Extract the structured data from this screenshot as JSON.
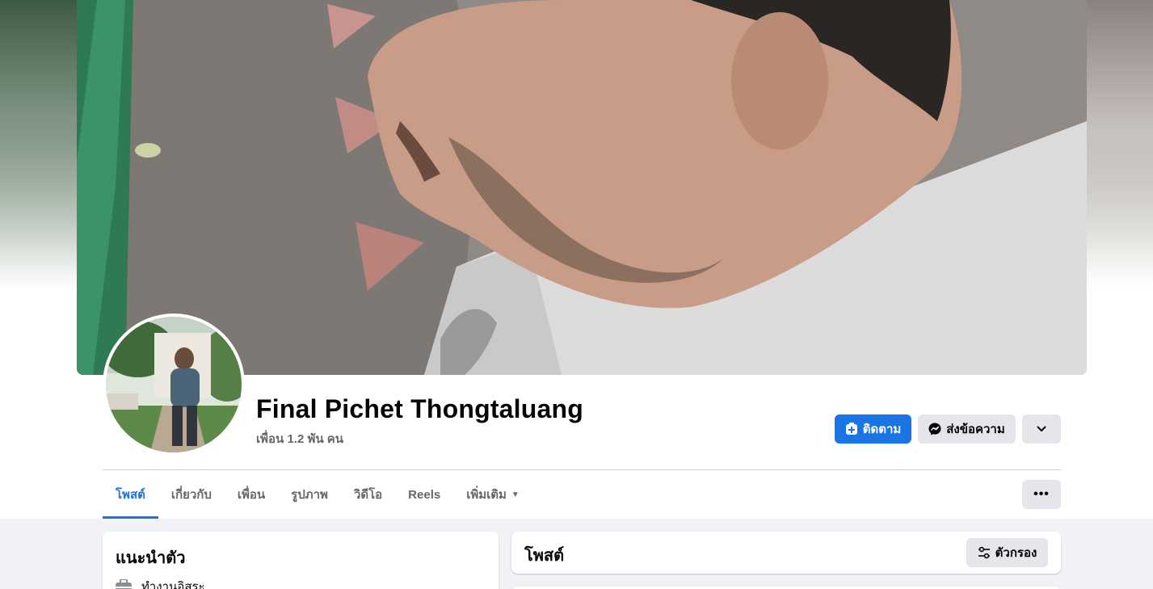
{
  "profile": {
    "name": "Final Pichet Thongtaluang",
    "friends_text": "เพื่อน 1.2 พัน คน"
  },
  "actions": {
    "follow_label": "ติดตาม",
    "message_label": "ส่งข้อความ"
  },
  "tabs": [
    {
      "label": "โพสต์",
      "active": true
    },
    {
      "label": "เกี่ยวกับ"
    },
    {
      "label": "เพื่อน"
    },
    {
      "label": "รูปภาพ"
    },
    {
      "label": "วิดีโอ"
    },
    {
      "label": "Reels"
    },
    {
      "label": "เพิ่มเติม"
    }
  ],
  "intro": {
    "title": "แนะนำตัว",
    "work": "ทำงานอิสระ"
  },
  "posts": {
    "title": "โพสต์",
    "filter_label": "ตัวกรอง"
  },
  "icons": {
    "follow": "add-friend-icon",
    "message": "messenger-icon",
    "more": "chevron-down-icon",
    "tab_more": "more-horizontal-icon",
    "filter": "filter-icon",
    "work": "briefcase-icon"
  },
  "colors": {
    "accent": "#1b74e4",
    "page_bg": "#f0f2f5",
    "secondary_button": "#e4e6eb",
    "secondary_text": "#65676b"
  }
}
